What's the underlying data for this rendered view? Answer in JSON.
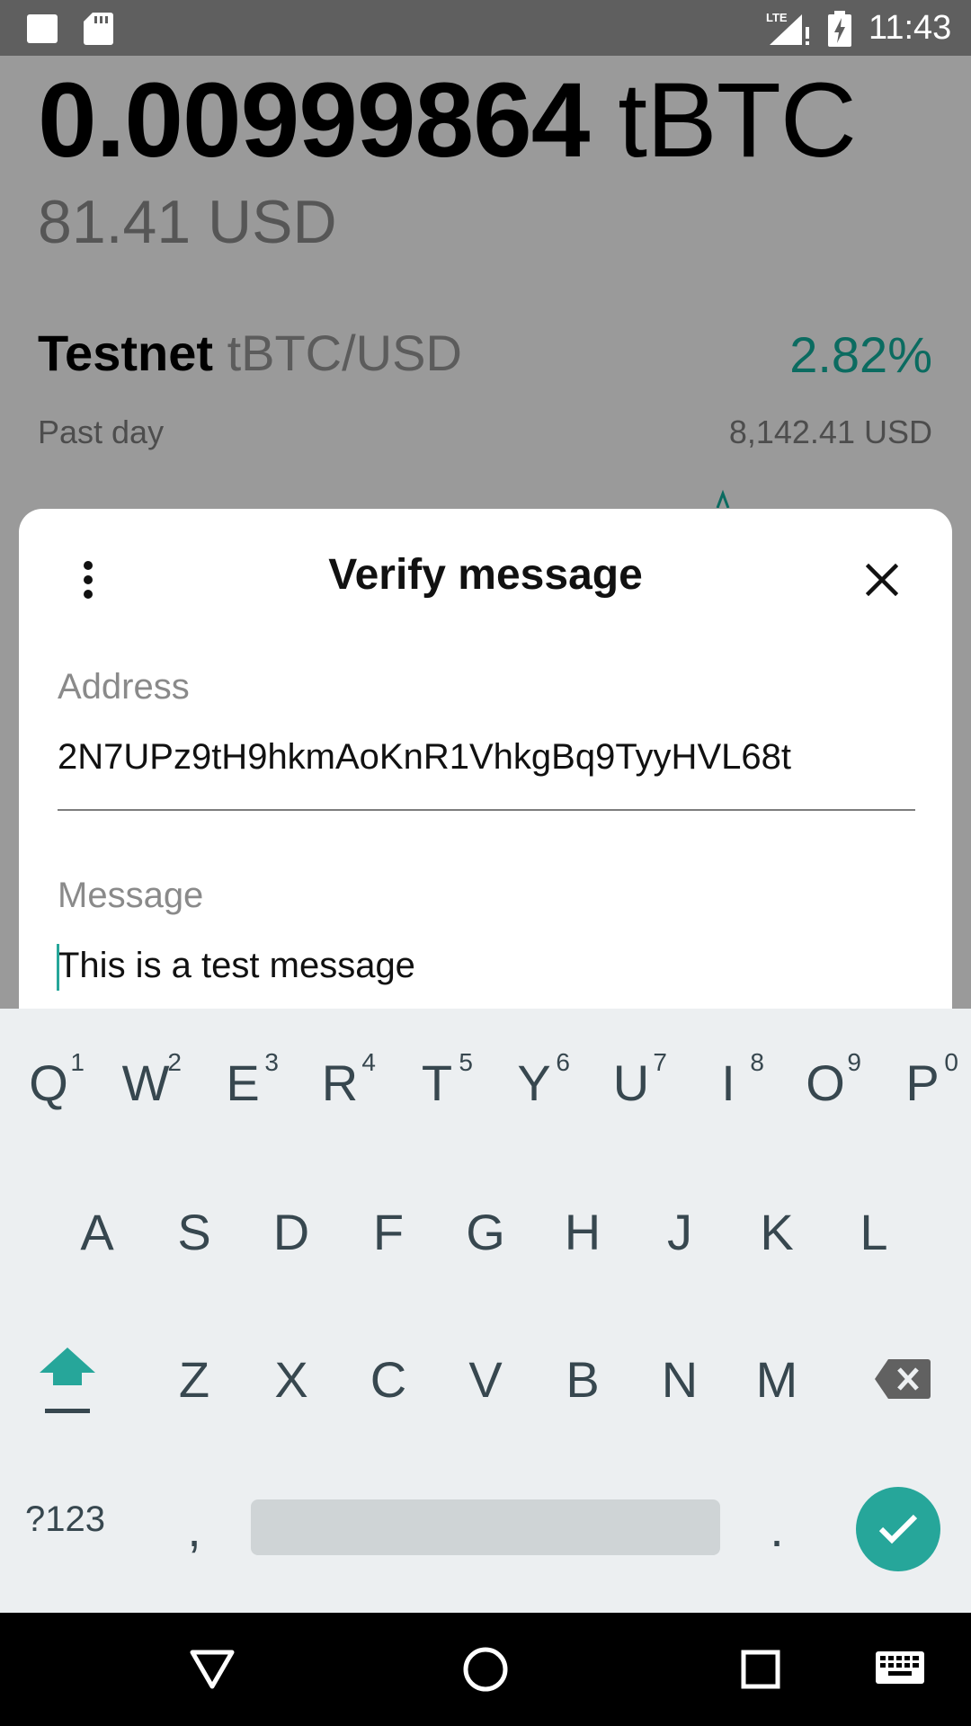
{
  "status_bar": {
    "time": "11:43",
    "network": "LTE"
  },
  "wallet": {
    "balance_amount": "0.00999864",
    "balance_unit": "tBTC",
    "fiat_value": "81.41 USD",
    "network_name": "Testnet",
    "pair": "tBTC/USD",
    "change": "2.82%",
    "period": "Past day",
    "price": "8,142.41 USD"
  },
  "dialog": {
    "title": "Verify message",
    "address_label": "Address",
    "address_value": "2N7UPz9tH9hkmAoKnR1VhkgBq9TyyHVL68t",
    "message_label": "Message",
    "message_value": "This is a test message"
  },
  "keyboard": {
    "row1": [
      {
        "key": "Q",
        "hint": "1"
      },
      {
        "key": "W",
        "hint": "2"
      },
      {
        "key": "E",
        "hint": "3"
      },
      {
        "key": "R",
        "hint": "4"
      },
      {
        "key": "T",
        "hint": "5"
      },
      {
        "key": "Y",
        "hint": "6"
      },
      {
        "key": "U",
        "hint": "7"
      },
      {
        "key": "I",
        "hint": "8"
      },
      {
        "key": "O",
        "hint": "9"
      },
      {
        "key": "P",
        "hint": "0"
      }
    ],
    "row2": [
      "A",
      "S",
      "D",
      "F",
      "G",
      "H",
      "J",
      "K",
      "L"
    ],
    "row3": [
      "Z",
      "X",
      "C",
      "V",
      "B",
      "N",
      "M"
    ],
    "symbols_key": "?123",
    "comma_key": ",",
    "period_key": "."
  },
  "colors": {
    "accent": "#26a69a",
    "change_text": "#0b6b60"
  },
  "icons": [
    "more-vert",
    "close",
    "shift",
    "backspace",
    "enter-check",
    "nav-back",
    "nav-home",
    "nav-recents",
    "keyboard"
  ]
}
